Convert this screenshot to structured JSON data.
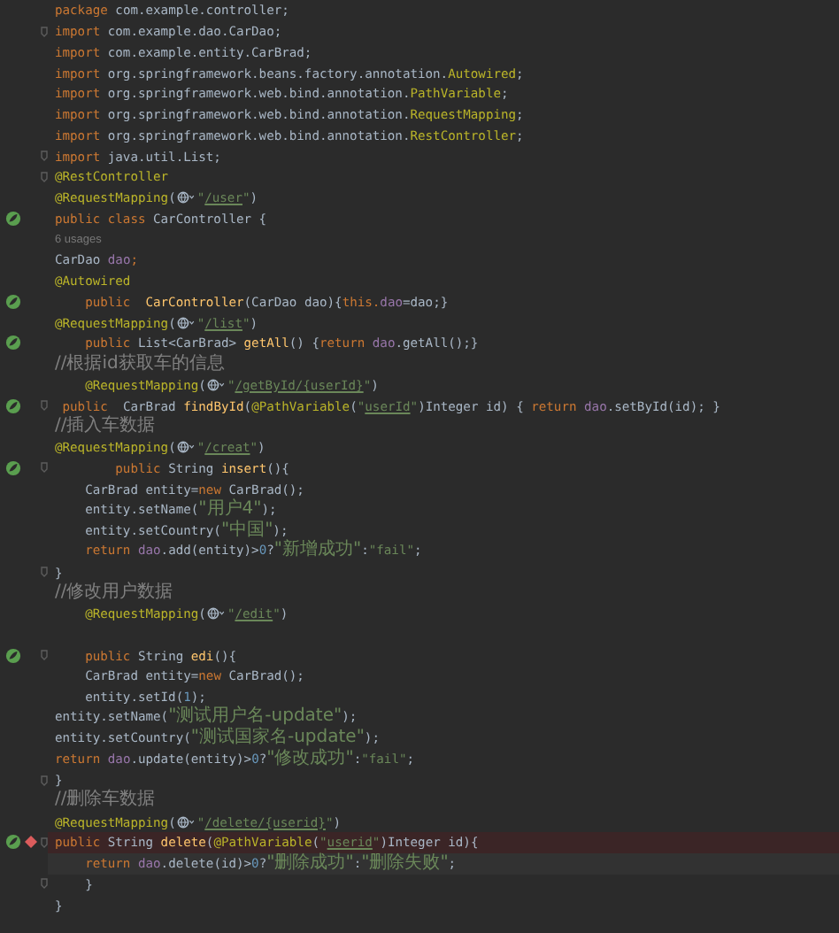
{
  "editor": {
    "lines": [
      {
        "tokens": [
          {
            "kind": "kw",
            "text": "package"
          },
          {
            "kind": "p",
            "text": " com.example.controller;"
          }
        ]
      },
      {
        "fold": true,
        "tokens": [
          {
            "kind": "kw",
            "text": "import"
          },
          {
            "kind": "p",
            "text": " com.example.dao.CarDao;"
          }
        ]
      },
      {
        "tokens": [
          {
            "kind": "kw",
            "text": "import"
          },
          {
            "kind": "p",
            "text": " com.example.entity.CarBrad;"
          }
        ]
      },
      {
        "tokens": [
          {
            "kind": "kw",
            "text": "import"
          },
          {
            "kind": "p",
            "text": " org.springframework.beans.factory.annotation."
          },
          {
            "kind": "ann",
            "text": "Autowired"
          },
          {
            "kind": "p",
            "text": ";"
          }
        ]
      },
      {
        "tokens": [
          {
            "kind": "kw",
            "text": "import"
          },
          {
            "kind": "p",
            "text": " org.springframework.web.bind.annotation."
          },
          {
            "kind": "ann",
            "text": "PathVariable"
          },
          {
            "kind": "p",
            "text": ";"
          }
        ]
      },
      {
        "tokens": [
          {
            "kind": "kw",
            "text": "import"
          },
          {
            "kind": "p",
            "text": " org.springframework.web.bind.annotation."
          },
          {
            "kind": "ann",
            "text": "RequestMapping"
          },
          {
            "kind": "p",
            "text": ";"
          }
        ]
      },
      {
        "tokens": [
          {
            "kind": "kw",
            "text": "import"
          },
          {
            "kind": "p",
            "text": " org.springframework.web.bind.annotation."
          },
          {
            "kind": "ann",
            "text": "RestController"
          },
          {
            "kind": "p",
            "text": ";"
          }
        ]
      },
      {
        "fold": true,
        "tokens": [
          {
            "kind": "kw",
            "text": "import"
          },
          {
            "kind": "p",
            "text": " java.util.List;"
          }
        ]
      },
      {
        "fold": true,
        "tokens": [
          {
            "kind": "ann",
            "text": "@RestController"
          }
        ]
      },
      {
        "tokens": [
          {
            "kind": "ann",
            "text": "@RequestMapping"
          },
          {
            "kind": "p",
            "text": "("
          },
          {
            "kind": "inlay"
          },
          {
            "kind": "str",
            "text": "\""
          },
          {
            "kind": "url",
            "text": "/user"
          },
          {
            "kind": "str",
            "text": "\""
          },
          {
            "kind": "p",
            "text": ")"
          }
        ]
      },
      {
        "spring_bean": true,
        "tokens": [
          {
            "kind": "kw",
            "text": "public class"
          },
          {
            "kind": "p",
            "text": " CarController {"
          }
        ]
      },
      {
        "tokens": [
          {
            "kind": "hint",
            "text": "6 usages"
          }
        ]
      },
      {
        "tokens": [
          {
            "kind": "p",
            "text": "CarDao "
          },
          {
            "kind": "field",
            "text": "dao"
          },
          {
            "kind": "kw",
            "text": ";"
          }
        ]
      },
      {
        "tokens": [
          {
            "kind": "ann",
            "text": "@Autowired"
          }
        ]
      },
      {
        "spring_bean": true,
        "tokens": [
          {
            "kind": "kw",
            "text": "    public  "
          },
          {
            "kind": "method",
            "text": "CarController"
          },
          {
            "kind": "p",
            "text": "(CarDao dao){"
          },
          {
            "kind": "kw",
            "text": "this."
          },
          {
            "kind": "field",
            "text": "dao"
          },
          {
            "kind": "p",
            "text": "=dao;}"
          }
        ]
      },
      {
        "tokens": [
          {
            "kind": "ann",
            "text": "@RequestMapping"
          },
          {
            "kind": "p",
            "text": "("
          },
          {
            "kind": "inlay"
          },
          {
            "kind": "str",
            "text": "\""
          },
          {
            "kind": "url",
            "text": "/list"
          },
          {
            "kind": "str",
            "text": "\""
          },
          {
            "kind": "p",
            "text": ")"
          }
        ]
      },
      {
        "spring_bean": true,
        "tokens": [
          {
            "kind": "kw",
            "text": "    public"
          },
          {
            "kind": "p",
            "text": " List<CarBrad> "
          },
          {
            "kind": "method",
            "text": "getAll"
          },
          {
            "kind": "p",
            "text": "() {"
          },
          {
            "kind": "kw",
            "text": "return "
          },
          {
            "kind": "field",
            "text": "dao"
          },
          {
            "kind": "p",
            "text": ".getAll();}"
          }
        ]
      },
      {
        "tokens": [
          {
            "kind": "cmt",
            "text": "//根据id获取车的信息"
          }
        ]
      },
      {
        "tokens": [
          {
            "kind": "ann",
            "text": "    @RequestMapping"
          },
          {
            "kind": "p",
            "text": "("
          },
          {
            "kind": "inlay"
          },
          {
            "kind": "str",
            "text": "\""
          },
          {
            "kind": "url",
            "text": "/getById/{userId}"
          },
          {
            "kind": "str",
            "text": "\""
          },
          {
            "kind": "p",
            "text": ")"
          }
        ]
      },
      {
        "spring_bean": true,
        "fold": true,
        "tokens": [
          {
            "kind": "kw",
            "text": " public  "
          },
          {
            "kind": "p",
            "text": "CarBrad "
          },
          {
            "kind": "method",
            "text": "findById"
          },
          {
            "kind": "p",
            "text": "("
          },
          {
            "kind": "ann",
            "text": "@PathVariable"
          },
          {
            "kind": "p",
            "text": "("
          },
          {
            "kind": "str",
            "text": "\""
          },
          {
            "kind": "url",
            "text": "userId"
          },
          {
            "kind": "str",
            "text": "\""
          },
          {
            "kind": "p",
            "text": ")Integer id) { "
          },
          {
            "kind": "kw",
            "text": "return "
          },
          {
            "kind": "field",
            "text": "dao"
          },
          {
            "kind": "p",
            "text": ".setById(id); }"
          }
        ]
      },
      {
        "tokens": [
          {
            "kind": "cmt",
            "text": "//插入车数据"
          }
        ]
      },
      {
        "tokens": [
          {
            "kind": "ann",
            "text": "@RequestMapping"
          },
          {
            "kind": "p",
            "text": "("
          },
          {
            "kind": "inlay"
          },
          {
            "kind": "str",
            "text": "\""
          },
          {
            "kind": "url",
            "text": "/creat"
          },
          {
            "kind": "str",
            "text": "\""
          },
          {
            "kind": "p",
            "text": ")"
          }
        ]
      },
      {
        "spring_bean": true,
        "fold": true,
        "tokens": [
          {
            "kind": "kw",
            "text": "        public"
          },
          {
            "kind": "p",
            "text": " String "
          },
          {
            "kind": "method",
            "text": "insert"
          },
          {
            "kind": "p",
            "text": "(){"
          }
        ]
      },
      {
        "tokens": [
          {
            "kind": "p",
            "text": "    CarBrad entity="
          },
          {
            "kind": "kw",
            "text": "new"
          },
          {
            "kind": "p",
            "text": " CarBrad();"
          }
        ]
      },
      {
        "tokens": [
          {
            "kind": "p",
            "text": "    entity.setName("
          },
          {
            "kind": "strcn",
            "text": "\"用户4\""
          },
          {
            "kind": "p",
            "text": ");"
          }
        ]
      },
      {
        "tokens": [
          {
            "kind": "p",
            "text": "    entity.setCountry("
          },
          {
            "kind": "strcn",
            "text": "\"中国\""
          },
          {
            "kind": "p",
            "text": ");"
          }
        ]
      },
      {
        "tokens": [
          {
            "kind": "kw",
            "text": "    return "
          },
          {
            "kind": "field",
            "text": "dao"
          },
          {
            "kind": "p",
            "text": ".add(entity)>"
          },
          {
            "kind": "num",
            "text": "0"
          },
          {
            "kind": "p",
            "text": "?"
          },
          {
            "kind": "strcn",
            "text": "\"新增成功\""
          },
          {
            "kind": "p",
            "text": ":"
          },
          {
            "kind": "str",
            "text": "\"fail\""
          },
          {
            "kind": "p",
            "text": ";"
          }
        ]
      },
      {
        "fold": true,
        "tokens": [
          {
            "kind": "p",
            "text": "}"
          }
        ]
      },
      {
        "tokens": [
          {
            "kind": "cmt",
            "text": "//修改用户数据"
          }
        ]
      },
      {
        "tokens": [
          {
            "kind": "ann",
            "text": "    @RequestMapping"
          },
          {
            "kind": "p",
            "text": "("
          },
          {
            "kind": "inlay"
          },
          {
            "kind": "str",
            "text": "\""
          },
          {
            "kind": "url",
            "text": "/edit"
          },
          {
            "kind": "str",
            "text": "\""
          },
          {
            "kind": "p",
            "text": ")"
          }
        ]
      },
      {
        "blank": true
      },
      {
        "spring_bean": true,
        "fold": true,
        "tokens": [
          {
            "kind": "kw",
            "text": "    public"
          },
          {
            "kind": "p",
            "text": " String "
          },
          {
            "kind": "method",
            "text": "edi"
          },
          {
            "kind": "p",
            "text": "(){"
          }
        ]
      },
      {
        "tokens": [
          {
            "kind": "p",
            "text": "    CarBrad entity="
          },
          {
            "kind": "kw",
            "text": "new"
          },
          {
            "kind": "p",
            "text": " CarBrad();"
          }
        ]
      },
      {
        "tokens": [
          {
            "kind": "p",
            "text": "    entity.setId("
          },
          {
            "kind": "num",
            "text": "1"
          },
          {
            "kind": "p",
            "text": ");"
          }
        ]
      },
      {
        "tokens": [
          {
            "kind": "p",
            "text": "entity.setName("
          },
          {
            "kind": "strcn",
            "text": "\"测试用户名-update\""
          },
          {
            "kind": "p",
            "text": ");"
          }
        ]
      },
      {
        "tokens": [
          {
            "kind": "p",
            "text": "entity.setCountry("
          },
          {
            "kind": "strcn",
            "text": "\"测试国家名-update\""
          },
          {
            "kind": "p",
            "text": ");"
          }
        ]
      },
      {
        "tokens": [
          {
            "kind": "kw",
            "text": "return "
          },
          {
            "kind": "field",
            "text": "dao"
          },
          {
            "kind": "p",
            "text": ".update(entity)>"
          },
          {
            "kind": "num",
            "text": "0"
          },
          {
            "kind": "p",
            "text": "?"
          },
          {
            "kind": "strcn",
            "text": "\"修改成功\""
          },
          {
            "kind": "p",
            "text": ":"
          },
          {
            "kind": "str",
            "text": "\"fail\""
          },
          {
            "kind": "p",
            "text": ";"
          }
        ]
      },
      {
        "fold": true,
        "tokens": [
          {
            "kind": "p",
            "text": "}"
          }
        ]
      },
      {
        "tokens": [
          {
            "kind": "cmt",
            "text": "//删除车数据"
          }
        ]
      },
      {
        "tokens": [
          {
            "kind": "ann",
            "text": "@RequestMapping"
          },
          {
            "kind": "p",
            "text": "("
          },
          {
            "kind": "inlay"
          },
          {
            "kind": "str",
            "text": "\""
          },
          {
            "kind": "url",
            "text": "/delete/{userid}"
          },
          {
            "kind": "str",
            "text": "\""
          },
          {
            "kind": "p",
            "text": ")"
          }
        ]
      },
      {
        "spring_bean": true,
        "breakpoint": true,
        "fold": true,
        "tokens": [
          {
            "kind": "kw",
            "text": "public"
          },
          {
            "kind": "p",
            "text": " String "
          },
          {
            "kind": "method",
            "text": "delete"
          },
          {
            "kind": "p",
            "text": "("
          },
          {
            "kind": "ann",
            "text": "@PathVariable"
          },
          {
            "kind": "p",
            "text": "("
          },
          {
            "kind": "str",
            "text": "\""
          },
          {
            "kind": "url",
            "text": "userid"
          },
          {
            "kind": "str",
            "text": "\""
          },
          {
            "kind": "p",
            "text": ")Integer id){"
          }
        ]
      },
      {
        "current": true,
        "tokens": [
          {
            "kind": "kw",
            "text": "    return "
          },
          {
            "kind": "field",
            "text": "dao"
          },
          {
            "kind": "p",
            "text": ".delete(id)>"
          },
          {
            "kind": "num",
            "text": "0"
          },
          {
            "kind": "p",
            "text": "?"
          },
          {
            "kind": "strcn",
            "text": "\"删除成功\""
          },
          {
            "kind": "p",
            "text": ":"
          },
          {
            "kind": "strcn",
            "text": "\"删除失败\""
          },
          {
            "kind": "p",
            "text": ";"
          }
        ]
      },
      {
        "fold": true,
        "tokens": [
          {
            "kind": "p",
            "text": "    }"
          }
        ]
      },
      {
        "tokens": [
          {
            "kind": "p",
            "text": "}"
          }
        ]
      }
    ]
  }
}
